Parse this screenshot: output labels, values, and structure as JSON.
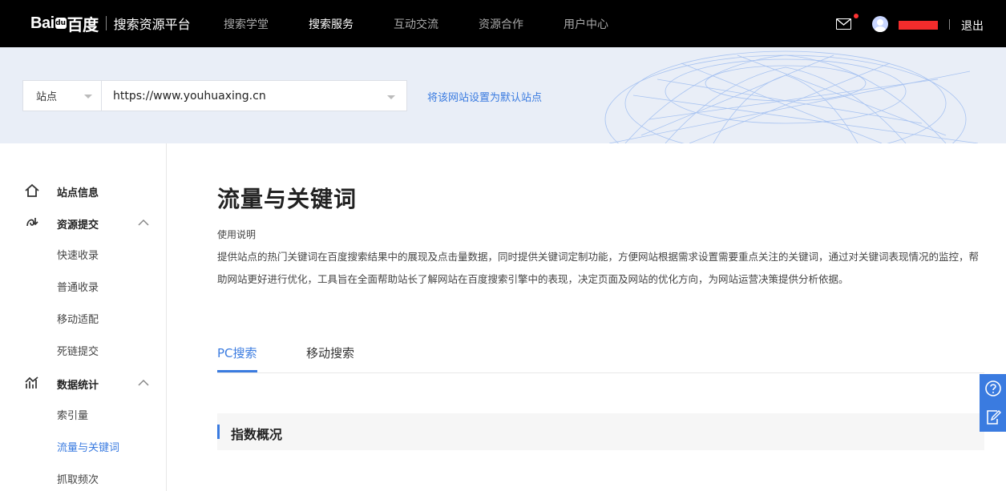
{
  "header": {
    "logo_text": "Bai",
    "logo_paw": "du",
    "logo_cn": "百度",
    "platform_name": "搜索资源平台",
    "nav": [
      {
        "label": "搜索学堂",
        "active": false
      },
      {
        "label": "搜索服务",
        "active": true
      },
      {
        "label": "互动交流",
        "active": false
      },
      {
        "label": "资源合作",
        "active": false
      },
      {
        "label": "用户中心",
        "active": false
      }
    ],
    "logout_label": "退出",
    "notification_dot_color": "#ff3333"
  },
  "banner": {
    "site_select_label": "站点",
    "site_url": "https://www.youhuaxing.cn",
    "default_site_link": "将该网站设置为默认站点"
  },
  "sidebar": {
    "groups": [
      {
        "label": "站点信息",
        "icon": "home-icon",
        "expanded": false,
        "items": []
      },
      {
        "label": "资源提交",
        "icon": "resource-submit-icon",
        "expanded": true,
        "items": [
          {
            "label": "快速收录",
            "active": false
          },
          {
            "label": "普通收录",
            "active": false
          },
          {
            "label": "移动适配",
            "active": false
          },
          {
            "label": "死链提交",
            "active": false
          }
        ]
      },
      {
        "label": "数据统计",
        "icon": "chart-bars-icon",
        "expanded": true,
        "items": [
          {
            "label": "索引量",
            "active": false
          },
          {
            "label": "流量与关键词",
            "active": true
          },
          {
            "label": "抓取频次",
            "active": false
          }
        ]
      }
    ]
  },
  "main": {
    "title": "流量与关键词",
    "usage_label": "使用说明",
    "usage_description": "提供站点的热门关键词在百度搜索结果中的展现及点击量数据，同时提供关键词定制功能，方便网站根据需求设置需要重点关注的关键词，通过对关键词表现情况的监控，帮助网站更好进行优化，工具旨在全面帮助站长了解网站在百度搜索引擎中的表现，决定页面及网站的优化方向，为网站运营决策提供分析依据。",
    "tabs": [
      {
        "label": "PC搜索",
        "active": true
      },
      {
        "label": "移动搜索",
        "active": false
      }
    ],
    "section_title": "指数概况"
  },
  "float_tools": {
    "items": [
      "help-icon",
      "feedback-icon"
    ]
  },
  "colors": {
    "accent": "#3a7be0",
    "topbar": "#000000",
    "banner_bg": "#e9eef7"
  }
}
